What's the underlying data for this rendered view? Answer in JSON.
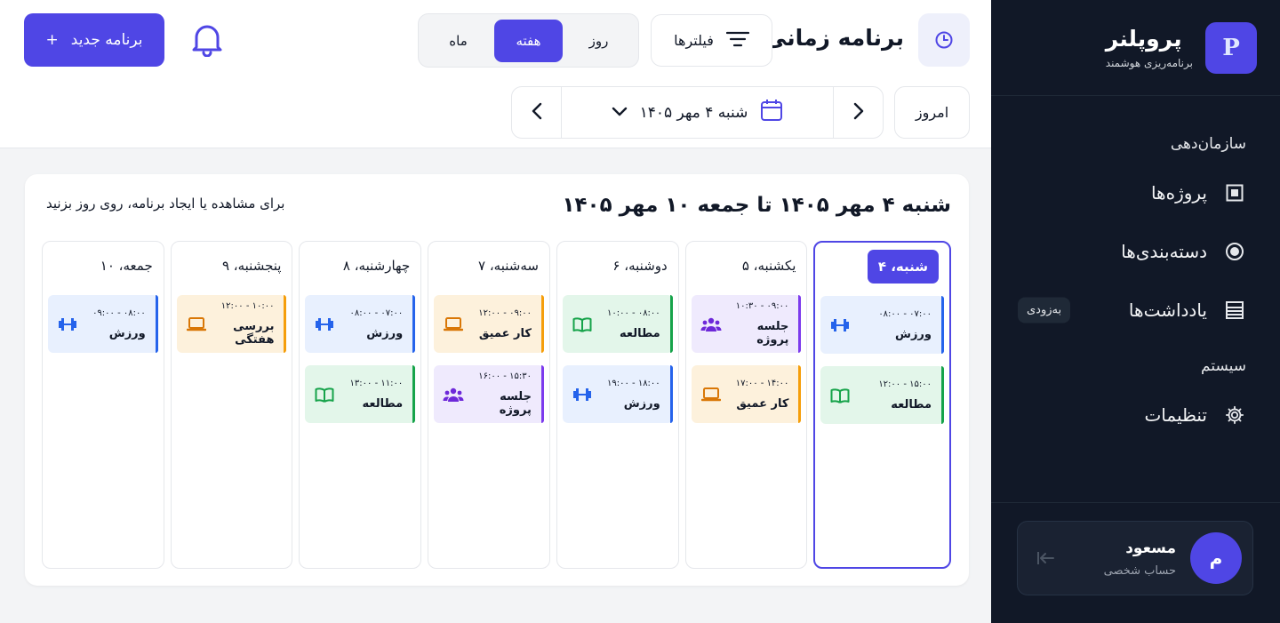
{
  "sidebar": {
    "brand": {
      "logo_letter": "P",
      "name": "پروپلنر",
      "tagline": "برنامه‌ریزی هوشمند"
    },
    "sections": [
      {
        "title": "سازمان‌دهی",
        "items": [
          {
            "label": "پروژه‌ها",
            "icon": "square-icon"
          },
          {
            "label": "دسته‌بندی‌ها",
            "icon": "circle-dot-icon"
          },
          {
            "label": "یادداشت‌ها",
            "icon": "notes-icon",
            "badge": "به‌زودی"
          }
        ]
      },
      {
        "title": "سیستم",
        "items": [
          {
            "label": "تنظیمات",
            "icon": "gear-icon"
          }
        ]
      }
    ],
    "user": {
      "initial": "م",
      "name": "مسعود",
      "role": "حساب شخصی"
    }
  },
  "header": {
    "title": "برنامه زمانی",
    "filters_label": "فیلترها",
    "view_tabs": [
      "روز",
      "هفته",
      "ماه"
    ],
    "active_view": "هفته",
    "new_button": "برنامه جدید",
    "today_button": "امروز",
    "current_date": "شنبه ۴ مهر ۱۴۰۵"
  },
  "week": {
    "title": "شنبه ۴ مهر ۱۴۰۵ تا جمعه ۱۰ مهر ۱۴۰۵",
    "hint": "برای مشاهده یا ایجاد برنامه، روی روز بزنید",
    "days": [
      {
        "label": "شنبه، ۴",
        "selected": true,
        "events": [
          {
            "time": "۰۸:۰۰ - ۰۷:۰۰",
            "title": "ورزش",
            "color": "blue",
            "icon": "dumbbell-icon"
          },
          {
            "time": "۱۲:۰۰ - ۱۵:۰۰",
            "title": "مطالعه",
            "color": "green",
            "icon": "book-icon"
          }
        ]
      },
      {
        "label": "یکشنبه، ۵",
        "events": [
          {
            "time": "۱۰:۳۰ - ۰۹:۰۰",
            "title": "جلسه پروژه",
            "color": "purple",
            "icon": "users-icon"
          },
          {
            "time": "۱۷:۰۰ - ۱۴:۰۰",
            "title": "کار عمیق",
            "color": "orange",
            "icon": "laptop-icon"
          }
        ]
      },
      {
        "label": "دوشنبه، ۶",
        "events": [
          {
            "time": "۱۰:۰۰ - ۰۸:۰۰",
            "title": "مطالعه",
            "color": "green",
            "icon": "book-icon"
          },
          {
            "time": "۱۹:۰۰ - ۱۸:۰۰",
            "title": "ورزش",
            "color": "blue",
            "icon": "dumbbell-icon"
          }
        ]
      },
      {
        "label": "سه‌شنبه، ۷",
        "events": [
          {
            "time": "۱۲:۰۰ - ۰۹:۰۰",
            "title": "کار عمیق",
            "color": "orange",
            "icon": "laptop-icon"
          },
          {
            "time": "۱۶:۰۰ - ۱۵:۳۰",
            "title": "جلسه پروژه",
            "color": "purple",
            "icon": "users-icon"
          }
        ]
      },
      {
        "label": "چهارشنبه، ۸",
        "events": [
          {
            "time": "۰۸:۰۰ - ۰۷:۰۰",
            "title": "ورزش",
            "color": "blue",
            "icon": "dumbbell-icon"
          },
          {
            "time": "۱۳:۰۰ - ۱۱:۰۰",
            "title": "مطالعه",
            "color": "green",
            "icon": "book-icon"
          }
        ]
      },
      {
        "label": "پنجشنبه، ۹",
        "events": [
          {
            "time": "۱۲:۰۰ - ۱۰:۰۰",
            "title": "بررسی هفتگی",
            "color": "orange",
            "icon": "laptop-icon"
          }
        ]
      },
      {
        "label": "جمعه، ۱۰",
        "events": [
          {
            "time": "۰۹:۰۰ - ۰۸:۰۰",
            "title": "ورزش",
            "color": "blue",
            "icon": "dumbbell-icon"
          }
        ]
      }
    ]
  },
  "colors": {
    "accent": "#4f46e5",
    "sidebar_bg": "#111827",
    "blue": "#2563eb",
    "green": "#16a34a",
    "orange": "#f59e0b",
    "purple": "#7c3aed"
  }
}
